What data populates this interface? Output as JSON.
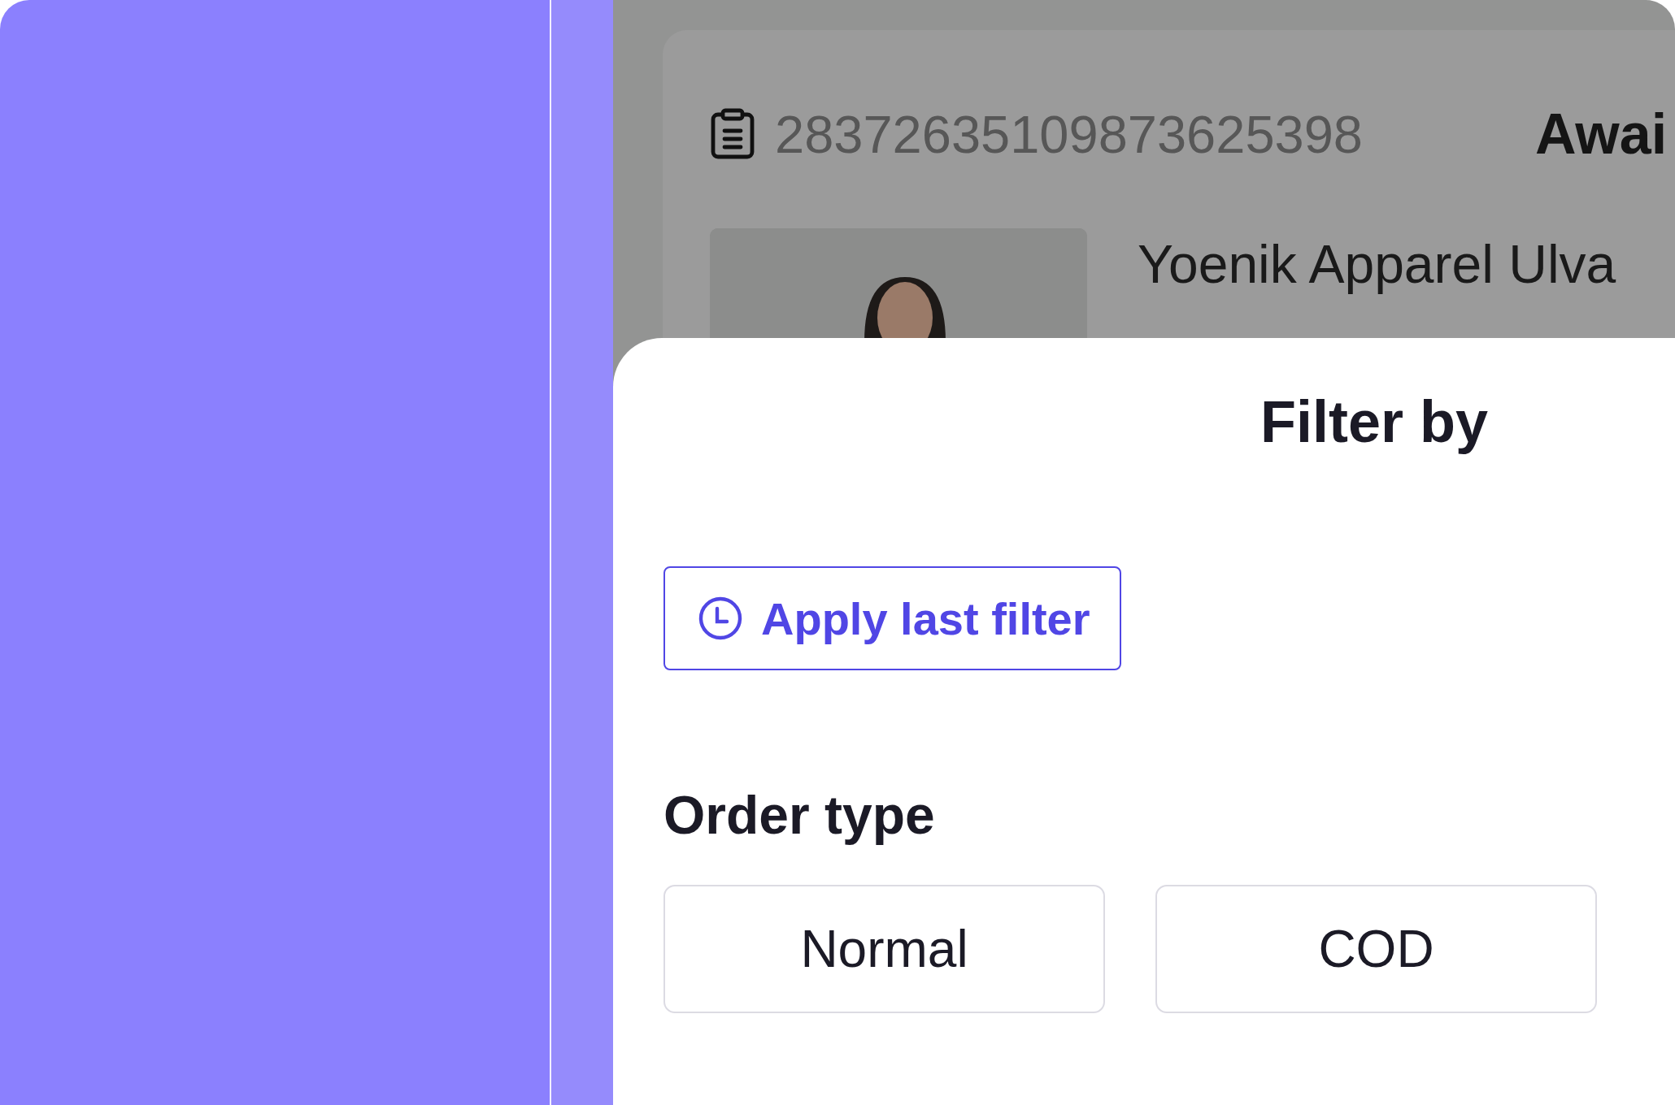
{
  "order": {
    "number": "28372635109873625398",
    "status": "Awai"
  },
  "product": {
    "title": "Yoenik Apparel Ulva"
  },
  "sheet": {
    "title": "Filter by",
    "apply_last_filter": "Apply last filter",
    "sections": [
      {
        "title": "Order type",
        "options": [
          {
            "label": "Normal",
            "selected": false
          },
          {
            "label": "COD",
            "selected": false
          }
        ]
      }
    ]
  }
}
